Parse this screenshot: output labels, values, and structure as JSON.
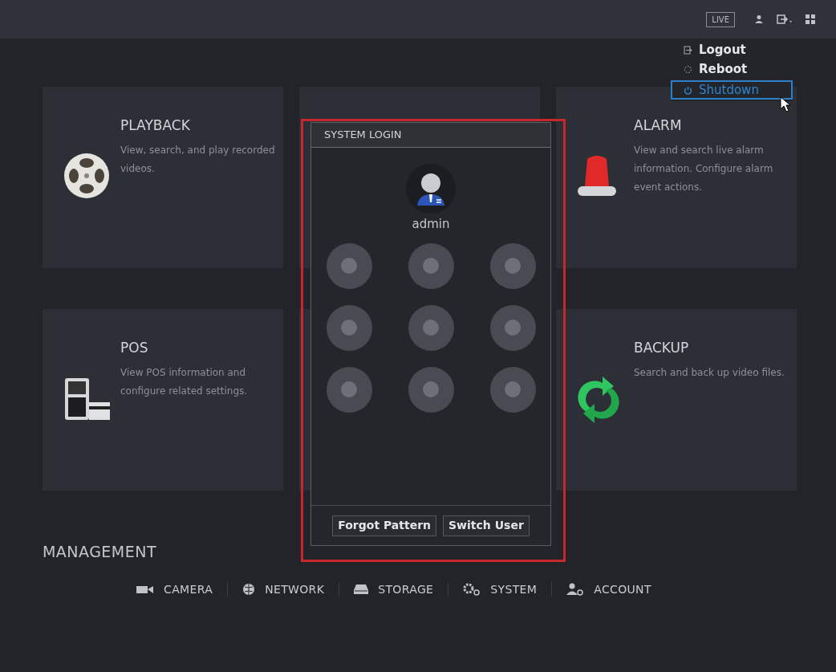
{
  "top_bar": {
    "live_button": "LIVE"
  },
  "menu": [
    {
      "label": "Logout",
      "selected": false
    },
    {
      "label": "Reboot",
      "selected": false
    },
    {
      "label": "Shutdown",
      "selected": true
    }
  ],
  "modules": [
    {
      "title": "PLAYBACK",
      "description": "View, search, and play recorded videos."
    },
    {
      "title": "ALARM",
      "description": "View and search live alarm information. Configure alarm event actions."
    },
    {
      "title": "POS",
      "description": "View POS information and configure related settings."
    },
    {
      "title": "BACKUP",
      "description": "Search and back up video files."
    }
  ],
  "login": {
    "title": "SYSTEM LOGIN",
    "user": "admin",
    "buttons": [
      "Forgot Pattern",
      "Switch User"
    ]
  },
  "management": {
    "title": "MANAGEMENT",
    "items": [
      "CAMERA",
      "NETWORK",
      "STORAGE",
      "SYSTEM",
      "ACCOUNT"
    ]
  }
}
